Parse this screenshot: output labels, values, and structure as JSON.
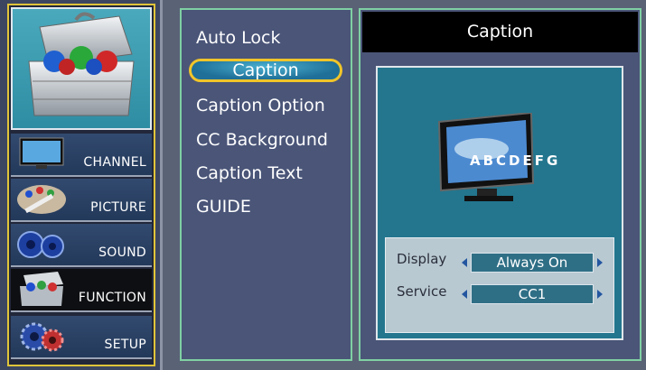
{
  "nav": {
    "items": [
      {
        "label": "CHANNEL",
        "icon": "tv-icon"
      },
      {
        "label": "PICTURE",
        "icon": "palette-icon"
      },
      {
        "label": "SOUND",
        "icon": "speaker-icon"
      },
      {
        "label": "FUNCTION",
        "icon": "toolbox-icon",
        "active": true
      },
      {
        "label": "SETUP",
        "icon": "gears-icon"
      }
    ],
    "hero_icon": "toolbox-icon"
  },
  "menu": {
    "items": [
      {
        "label": "Auto Lock"
      },
      {
        "label": "Caption",
        "selected": true
      },
      {
        "label": "Caption Option"
      },
      {
        "label": "CC Background"
      },
      {
        "label": "Caption Text"
      },
      {
        "label": "GUIDE"
      }
    ]
  },
  "panel": {
    "title": "Caption",
    "preview_letters": "ABCDEFG",
    "settings": [
      {
        "label": "Display",
        "value": "Always On"
      },
      {
        "label": "Service",
        "value": "CC1"
      }
    ]
  },
  "colors": {
    "highlight_border": "#f0c52a",
    "panel_border": "#7fd0a3",
    "panel_bg": "#4a5578"
  }
}
